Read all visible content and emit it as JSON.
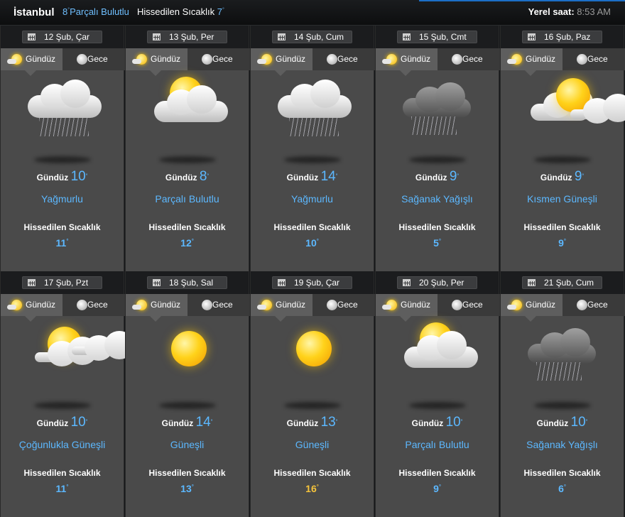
{
  "header": {
    "city": "İstanbul",
    "current_temp": "8",
    "current_condition": "Parçalı Bulutlu",
    "feels_label": "Hissedilen Sıcaklık",
    "feels_value": "7",
    "local_time_label": "Yerel saat:",
    "local_time": "8:53 AM"
  },
  "tabs": {
    "day": "Gündüz",
    "night": "Gece"
  },
  "day_label": "Gündüz",
  "feels_label": "Hissedilen Sıcaklık",
  "days": [
    {
      "date": "12 Şub, Çar",
      "temp": "10",
      "condition": "Yağmurlu",
      "feels": "11",
      "icon": "rain-cloud-icon"
    },
    {
      "date": "13 Şub, Per",
      "temp": "8",
      "condition": "Parçalı Bulutlu",
      "feels": "12",
      "icon": "partly-cloudy-icon"
    },
    {
      "date": "14 Şub, Cum",
      "temp": "14",
      "condition": "Yağmurlu",
      "feels": "10",
      "icon": "rain-cloud-icon"
    },
    {
      "date": "15 Şub, Cmt",
      "temp": "9",
      "condition": "Sağanak Yağışlı",
      "feels": "5",
      "icon": "storm-cloud-icon"
    },
    {
      "date": "16 Şub, Paz",
      "temp": "9",
      "condition": "Kısmen Güneşli",
      "feels": "9",
      "icon": "sun-cloud-icon"
    },
    {
      "date": "17 Şub, Pzt",
      "temp": "10",
      "condition": "Çoğunlukla Güneşli",
      "feels": "11",
      "icon": "mostly-sunny-icon"
    },
    {
      "date": "18 Şub, Sal",
      "temp": "14",
      "condition": "Güneşli",
      "feels": "13",
      "icon": "sun-icon"
    },
    {
      "date": "19 Şub, Çar",
      "temp": "13",
      "condition": "Güneşli",
      "feels": "16",
      "icon": "sun-icon"
    },
    {
      "date": "20 Şub, Per",
      "temp": "10",
      "condition": "Parçalı Bulutlu",
      "feels": "9",
      "icon": "partly-cloudy-icon"
    },
    {
      "date": "21 Şub, Cum",
      "temp": "10",
      "condition": "Sağanak Yağışlı",
      "feels": "6",
      "icon": "storm-cloud-icon"
    }
  ],
  "colors": {
    "accent": "#5cb8ff",
    "warm": "#f5c33b",
    "card": "#4a4a4a"
  }
}
